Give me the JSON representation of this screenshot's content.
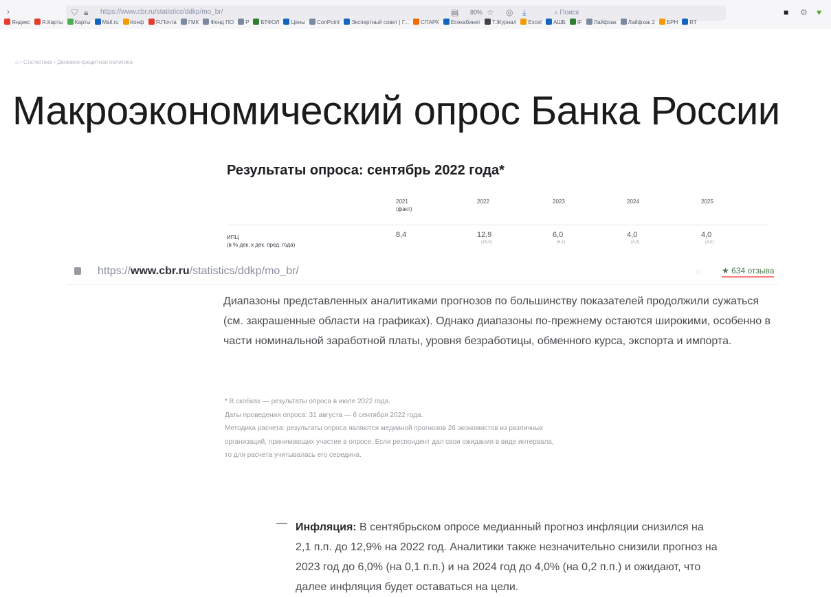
{
  "browser": {
    "url": "https://www.cbr.ru/statistics/ddkp/mo_br/",
    "zoom": "80%",
    "search_placeholder": "Поиск",
    "bookmarks": [
      {
        "label": "Яндекс",
        "color": "#e63b2e"
      },
      {
        "label": "Я.Карты",
        "color": "#e63b2e"
      },
      {
        "label": "Карты",
        "color": "#4caf50"
      },
      {
        "label": "Mail.ru",
        "color": "#1565c0"
      },
      {
        "label": "Конф",
        "color": "#f59a00"
      },
      {
        "label": "Я.Почта",
        "color": "#e63b2e"
      },
      {
        "label": "ГМК",
        "color": "#7b8aa0"
      },
      {
        "label": "Фонд ПО",
        "color": "#7b8aa0"
      },
      {
        "label": "Р",
        "color": "#7b8aa0"
      },
      {
        "label": "БТФОЛ",
        "color": "#2e7d32"
      },
      {
        "label": "Цены",
        "color": "#1565c0"
      },
      {
        "label": "ConPoint",
        "color": "#7b8aa0"
      },
      {
        "label": "Экспертный совет | Г...",
        "color": "#1565c0"
      },
      {
        "label": "СПАРК",
        "color": "#ef6c00"
      },
      {
        "label": "Есекабинет",
        "color": "#1565c0"
      },
      {
        "label": "Т.Журнал",
        "color": "#444444"
      },
      {
        "label": "Excel",
        "color": "#f59a00"
      },
      {
        "label": "АШБ",
        "color": "#1565c0"
      },
      {
        "label": "IF",
        "color": "#2e7d32"
      },
      {
        "label": "Лайфхак",
        "color": "#7b8aa0"
      },
      {
        "label": "Лайфхак 2",
        "color": "#7b8aa0"
      },
      {
        "label": "БРН",
        "color": "#f59a00"
      },
      {
        "label": "RT",
        "color": "#1565c0"
      }
    ]
  },
  "breadcrumb": "⌂  ›  Статистика  ›  Денежно-кредитная политика",
  "page_title": "Макроэкономический опрос Банка России",
  "section_title": "Результаты опроса: сентябрь 2022 года*",
  "table": {
    "years": [
      {
        "line1": "2021",
        "line2": "(факт)"
      },
      {
        "line1": "2022",
        "line2": ""
      },
      {
        "line1": "2023",
        "line2": ""
      },
      {
        "line1": "2024",
        "line2": ""
      },
      {
        "line1": "2025",
        "line2": ""
      }
    ],
    "rows": [
      {
        "label": "ИПЦ",
        "label_sub": "(в % дек. к дек. пред. года)",
        "values": [
          {
            "v": "8,4",
            "prev": ""
          },
          {
            "v": "12,9",
            "prev": "(15,0)"
          },
          {
            "v": "6,0",
            "prev": "(6,1)"
          },
          {
            "v": "4,0",
            "prev": "(4,2)"
          },
          {
            "v": "4,0",
            "prev": "(4,0)"
          }
        ]
      }
    ]
  },
  "overlay": {
    "url_prefix": "https://",
    "url_host": "www.cbr.ru",
    "url_path": "/statistics/ddkp/mo_br/",
    "reviews": "★ 634 отзыва"
  },
  "paragraph": "Диапазоны представленных аналитиками прогнозов по большинству показателей продолжили сужаться (см. закрашенные области на графиках). Однако диапазоны по-прежнему остаются широкими, особенно в части номинальной заработной платы, уровня безработицы, обменного курса, экспорта и импорта.",
  "notes": [
    "* В скобках — результаты опроса в июле 2022 года.",
    "Даты проведения опроса: 31 августа — 6 сентября 2022 года.",
    "Методика расчета: результаты опроса являются медианой прогнозов 26 экономистов из различных",
    "организаций, принимающих участие в опросе. Если респондент дал свои ожидания в виде интервала,",
    "то для расчета учитывалась его середина."
  ],
  "bullet": {
    "dash": "—",
    "heading": "Инфляция:",
    "text": " В сентябрьском опросе медианный прогноз инфляции снизился на 2,1 п.п. до 12,9% на 2022 год. Аналитики также незначительно снизили прогноз на 2023 год до 6,0% (на 0,1 п.п.) и на 2024 год до 4,0% (на 0,2 п.п.) и ожидают, что далее инфляция будет оставаться на цели."
  }
}
